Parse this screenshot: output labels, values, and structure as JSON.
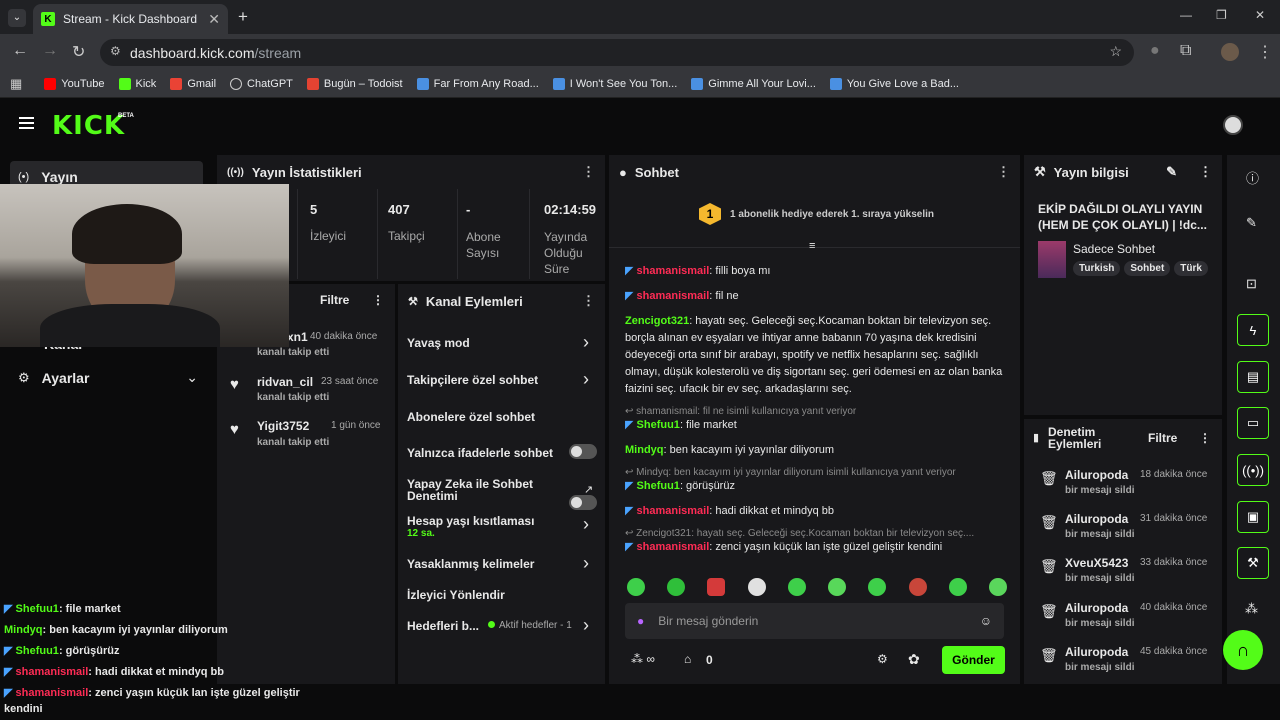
{
  "browser": {
    "tab_title": "Stream - Kick Dashboard",
    "url_host": "dashboard.kick.com",
    "url_path": "/stream",
    "bookmarks": [
      {
        "label": "YouTube",
        "color": "#ff0000"
      },
      {
        "label": "Kick",
        "color": "#53fc18"
      },
      {
        "label": "Gmail",
        "color": "#ea4335"
      },
      {
        "label": "ChatGPT",
        "color": "#cccccc"
      },
      {
        "label": "Bugün – Todoist",
        "color": "#e44332"
      },
      {
        "label": "Far From Any Road...",
        "color": "#4a90e2"
      },
      {
        "label": "I Won't See You Ton...",
        "color": "#4a90e2"
      },
      {
        "label": "Gimme All Your Lovi...",
        "color": "#4a90e2"
      },
      {
        "label": "You Give Love a Bad...",
        "color": "#4a90e2"
      }
    ]
  },
  "app": {
    "logo": "KICK",
    "beta": "BETA"
  },
  "sidebar": {
    "yayin": "Yayın",
    "kanal": "Kanal",
    "ayarlar": "Ayarlar"
  },
  "stats": {
    "title": "Yayın İstatistikleri",
    "items": [
      {
        "value": "5",
        "label": "İzleyici"
      },
      {
        "value": "407",
        "label": "Takipçi"
      },
      {
        "value": "-",
        "label": "Abone Sayısı"
      },
      {
        "value": "02:14:59",
        "label": "Yayında Olduğu Süre"
      }
    ]
  },
  "activity": {
    "filter": "Filtre",
    "items": [
      {
        "name": "xn1",
        "time": "40 dakika önce",
        "action": "kanalı takip etti"
      },
      {
        "name": "ridvan_cil",
        "time": "23 saat önce",
        "action": "kanalı takip etti"
      },
      {
        "name": "Yigit3752",
        "time": "1 gün önce",
        "action": "kanalı takip etti"
      }
    ]
  },
  "actions": {
    "title": "Kanal Eylemleri",
    "slow": "Yavaş mod",
    "followers": "Takipçilere özel sohbet",
    "subs": "Abonelere özel sohbet",
    "emotes": "Yalnızca ifadelerle sohbet",
    "ai1": "Yapay Zeka ile Sohbet",
    "ai2": "Denetimi",
    "age": "Hesap yaşı kısıtlaması",
    "age_val": "12 sa.",
    "banned": "Yasaklanmış kelimeler",
    "redirect": "İzleyici Yönlendir",
    "goals": "Hedefleri b...",
    "goals_status": "Aktif hedefler - 1"
  },
  "chat": {
    "title": "Sohbet",
    "rank": "1",
    "pinned": "1 abonelik hediye ederek 1. sıraya yükselin",
    "m1u": "shamanismail",
    "m1t": ": filli boya mı",
    "m2u": "shamanismail",
    "m2t": ": fil ne",
    "m3u": "Zencigot321",
    "m3t": ": hayatı seç. Geleceği seç.Kocaman boktan bir televizyon seç. borçla alınan ev eşyaları ve ihtiyar anne babanın 70 yaşına dek kredisini ödeyeceği orta sınıf bir arabayı, spotify ve netflix hesaplarını seç. sağlıklı olmayı, düşük kolesterolü ve diş sigortanı seç. geri ödemesi en az olan banka faizini seç. ufacık bir ev seç. arkadaşlarını seç.",
    "r4": "shamanismail: fil ne isimli kullanıcıya yanıt veriyor",
    "m4u": "Shefuu1",
    "m4t": ": file market",
    "m5u": "Mindyq",
    "m5t": ": ben kacayım iyi yayınlar diliyorum",
    "r6": "Mindyq: ben kacayım iyi yayınlar diliyorum  isimli kullanıcıya yanıt veriyor",
    "m6u": "Shefuu1",
    "m6t": ": görüşürüz",
    "m7u": "shamanismail",
    "m7t": ": hadi dikkat et mindyq bb",
    "r8": "Zencigot321: hayatı seç. Geleceği seç.Kocaman boktan bir televizyon seç....",
    "m8u": "shamanismail",
    "m8t": ": zenci yaşın küçük lan işte güzel geliştir kendini",
    "placeholder": "Bir mesaj gönderin",
    "points": "0",
    "send": "Gönder"
  },
  "info": {
    "title": "Yayın bilgisi",
    "stream_title": "EKİP DAĞILDI OLAYLI YAYIN (HEM DE ÇOK OLAYLI) | !dc...",
    "category": "Sadece Sohbet",
    "tags": [
      "Turkish",
      "Sohbet",
      "Türk"
    ]
  },
  "mod": {
    "title1": "Denetim",
    "title2": "Eylemleri",
    "filter": "Filtre",
    "items": [
      {
        "name": "Ailuropoda",
        "time": "18 dakika önce",
        "action": "bir mesajı sildi"
      },
      {
        "name": "Ailuropoda",
        "time": "31 dakika önce",
        "action": "bir mesajı sildi"
      },
      {
        "name": "XveuX5423",
        "time": "33 dakika önce",
        "action": "bir mesajı sildi"
      },
      {
        "name": "Ailuropoda",
        "time": "40 dakika önce",
        "action": "bir mesajı sildi"
      },
      {
        "name": "Ailuropoda",
        "time": "45 dakika önce",
        "action": "bir mesajı sildi"
      }
    ]
  },
  "overlay": {
    "l1u": "Shefuu1",
    "l1t": "file market",
    "l2u": "Mindyq",
    "l2t": "ben kacayım iyi yayınlar diliyorum",
    "l3u": "Shefuu1",
    "l3t": "görüşürüz",
    "l4u": "shamanismail",
    "l4t": "hadi dikkat et mindyq bb",
    "l5u": "shamanismail",
    "l5t": "zenci yaşın küçük lan işte güzel geliştir",
    "l6t": "kendini"
  }
}
